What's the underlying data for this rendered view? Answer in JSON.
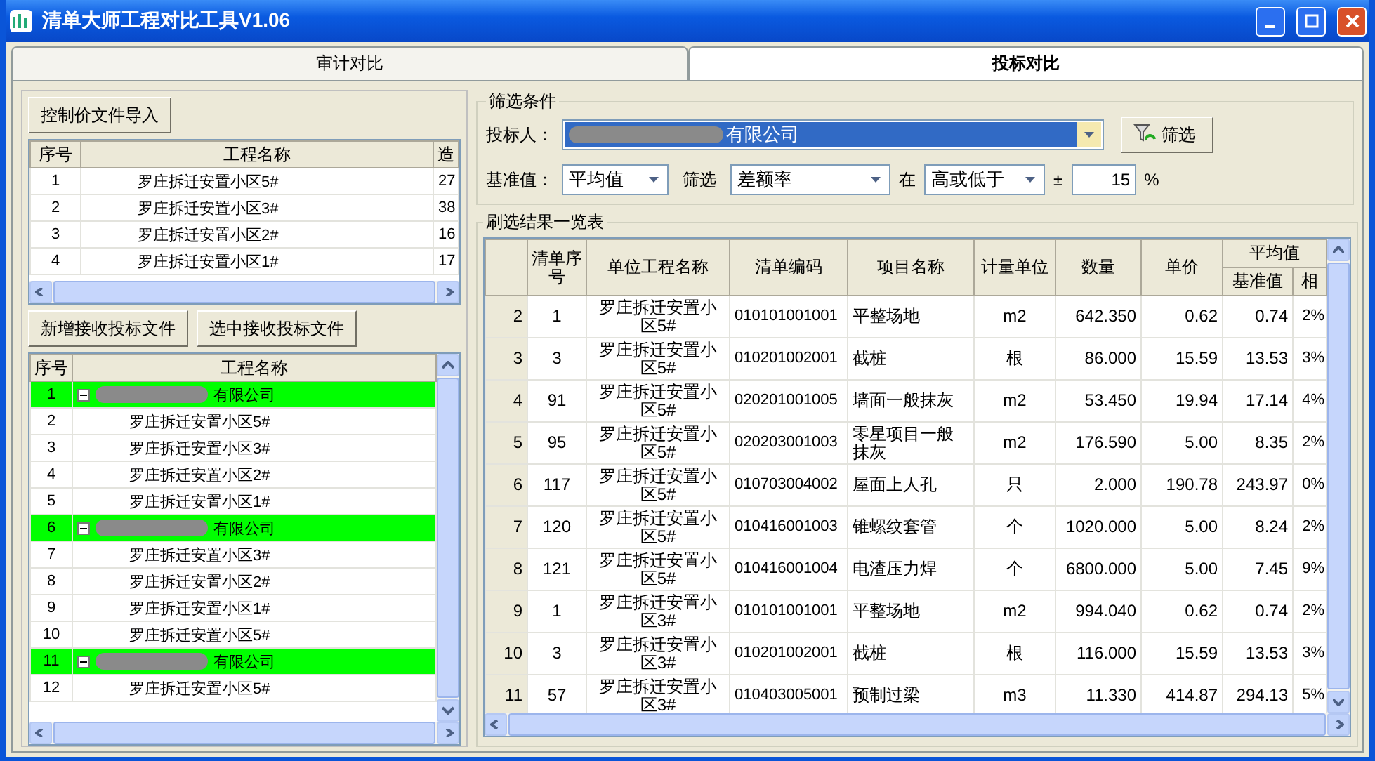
{
  "window": {
    "title": "清单大师工程对比工具V1.06"
  },
  "tabs": [
    {
      "label": "审计对比",
      "selected": false
    },
    {
      "label": "投标对比",
      "selected": true
    }
  ],
  "control_price": {
    "import_button": "控制价文件导入",
    "columns": [
      "序号",
      "工程名称",
      "造"
    ],
    "rows": [
      [
        "1",
        "罗庄拆迁安置小区5#",
        "27"
      ],
      [
        "2",
        "罗庄拆迁安置小区3#",
        "38"
      ],
      [
        "3",
        "罗庄拆迁安置小区2#",
        "16"
      ],
      [
        "4",
        "罗庄拆迁安置小区1#",
        "17"
      ]
    ]
  },
  "bid_buttons": [
    "新增接收投标文件",
    "选中接收投标文件"
  ],
  "bid_tree": {
    "columns": [
      "序号",
      "工程名称"
    ],
    "groups": [
      {
        "no": "1",
        "name": "有限公司",
        "expanded": true,
        "children": [
          {
            "no": "2",
            "name": "罗庄拆迁安置小区5#"
          },
          {
            "no": "3",
            "name": "罗庄拆迁安置小区3#"
          },
          {
            "no": "4",
            "name": "罗庄拆迁安置小区2#"
          },
          {
            "no": "5",
            "name": "罗庄拆迁安置小区1#"
          }
        ]
      },
      {
        "no": "6",
        "name": "有限公司",
        "expanded": true,
        "children": [
          {
            "no": "7",
            "name": "罗庄拆迁安置小区3#"
          },
          {
            "no": "8",
            "name": "罗庄拆迁安置小区2#"
          },
          {
            "no": "9",
            "name": "罗庄拆迁安置小区1#"
          },
          {
            "no": "10",
            "name": "罗庄拆迁安置小区5#"
          }
        ]
      },
      {
        "no": "11",
        "name": "有限公司",
        "expanded": true,
        "children": [
          {
            "no": "12",
            "name": "罗庄拆迁安置小区5#"
          }
        ]
      }
    ]
  },
  "filter": {
    "legend": "筛选条件",
    "bidder_label": "投标人：",
    "bidder_value": "有限公司",
    "filter_button": "筛选",
    "base_label": "基准值：",
    "base_value": "平均值",
    "filter_label": "筛选",
    "filter_value": "差额率",
    "at_label": "在",
    "direction_value": "高或低于",
    "plus_minus": "±",
    "percent_value": "15",
    "percent_sign": "%"
  },
  "results": {
    "legend": "刷选结果一览表",
    "columns": [
      "",
      "清单序号",
      "单位工程名称",
      "清单编码",
      "项目名称",
      "计量单位",
      "数量",
      "单价"
    ],
    "group_header": "平均值",
    "sub_columns": [
      "基准值",
      "相"
    ],
    "rows": [
      [
        "2",
        "1",
        "罗庄拆迁安置小区5#",
        "010101001001",
        "平整场地",
        "m2",
        "642.350",
        "0.62",
        "0.74",
        "2%"
      ],
      [
        "3",
        "3",
        "罗庄拆迁安置小区5#",
        "010201002001",
        "截桩",
        "根",
        "86.000",
        "15.59",
        "13.53",
        "3%"
      ],
      [
        "4",
        "91",
        "罗庄拆迁安置小区5#",
        "020201001005",
        "墙面一般抹灰",
        "m2",
        "53.450",
        "19.94",
        "17.14",
        "4%"
      ],
      [
        "5",
        "95",
        "罗庄拆迁安置小区5#",
        "020203001003",
        "零星项目一般抹灰",
        "m2",
        "176.590",
        "5.00",
        "8.35",
        "2%"
      ],
      [
        "6",
        "117",
        "罗庄拆迁安置小区5#",
        "010703004002",
        "屋面上人孔",
        "只",
        "2.000",
        "190.78",
        "243.97",
        "0%"
      ],
      [
        "7",
        "120",
        "罗庄拆迁安置小区5#",
        "010416001003",
        "锥螺纹套管",
        "个",
        "1020.000",
        "5.00",
        "8.24",
        "2%"
      ],
      [
        "8",
        "121",
        "罗庄拆迁安置小区5#",
        "010416001004",
        "电渣压力焊",
        "个",
        "6800.000",
        "5.00",
        "7.45",
        "9%"
      ],
      [
        "9",
        "1",
        "罗庄拆迁安置小区3#",
        "010101001001",
        "平整场地",
        "m2",
        "994.040",
        "0.62",
        "0.74",
        "2%"
      ],
      [
        "10",
        "3",
        "罗庄拆迁安置小区3#",
        "010201002001",
        "截桩",
        "根",
        "116.000",
        "15.59",
        "13.53",
        "3%"
      ],
      [
        "11",
        "57",
        "罗庄拆迁安置小区3#",
        "010403005001",
        "预制过梁",
        "m3",
        "11.330",
        "414.87",
        "294.13",
        "5%"
      ]
    ]
  }
}
